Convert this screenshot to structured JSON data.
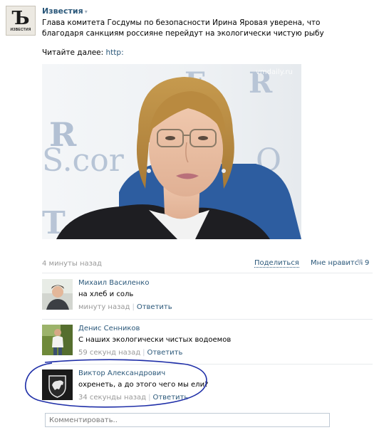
{
  "post": {
    "author": "Известия",
    "author_arrow": "▾",
    "logo_letter": "Ъ",
    "logo_caption": "ИЗВЕСТИЯ",
    "text": "Глава комитета Госдумы по безопасности Ирина Яровая уверена, что благодаря санкциям россияне перейдут на экологически чистую рыбу",
    "read_more_label": "Читайте далее:",
    "read_more_link": "http:",
    "photo_watermark": "vmdaily.ru",
    "time": "4 минуты назад",
    "share_label": "Поделиться",
    "like_label": "Мне нравится",
    "like_count": "9"
  },
  "comments": [
    {
      "name": "Михаил Василенко",
      "text": "на хлеб и соль",
      "time": "минуту назад",
      "reply_label": "Ответить"
    },
    {
      "name": "Денис Сенников",
      "text": "С наших экологически чистых водоемов",
      "time": "59 секунд назад",
      "reply_label": "Ответить"
    },
    {
      "name": "Виктор Александрович",
      "text": "охренеть, а до этого чего мы ели?",
      "time": "34 секунды назад",
      "reply_label": "Ответить"
    }
  ],
  "comment_input": {
    "placeholder": "Комментировать.."
  },
  "colors": {
    "link": "#2b587a",
    "muted": "#999999",
    "highlight_ellipse": "#1f2fa8"
  }
}
